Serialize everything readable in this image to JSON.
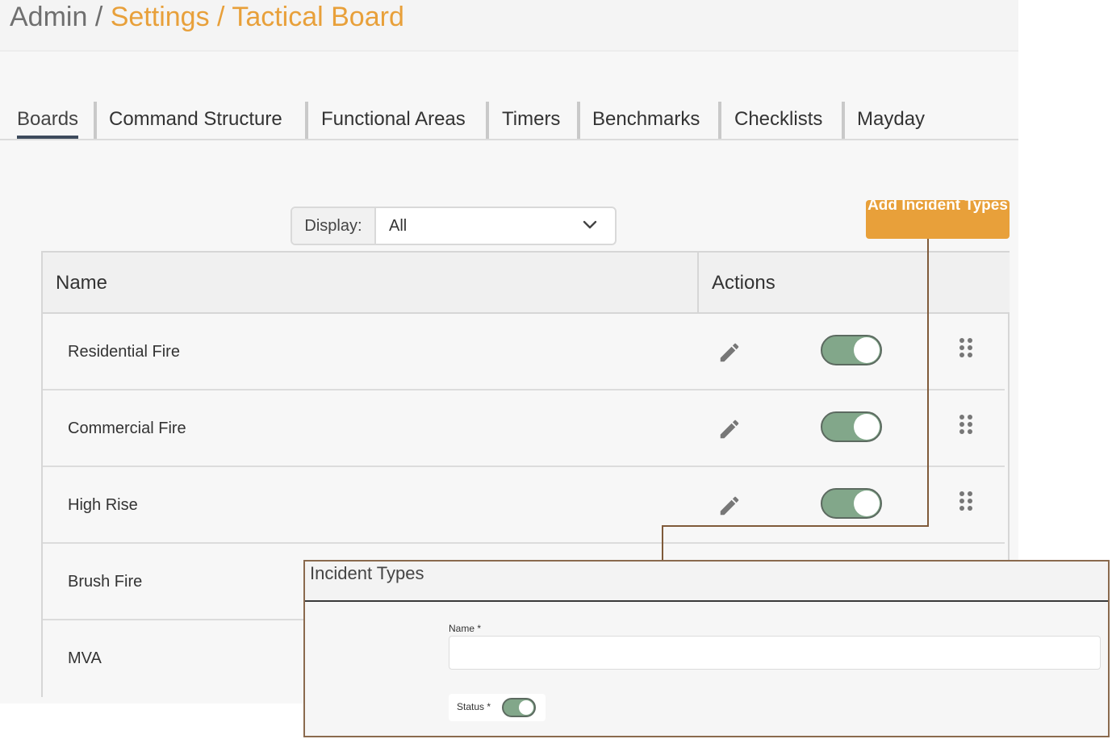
{
  "breadcrumb": {
    "root": "Admin",
    "separator1": " / ",
    "settings": "Settings",
    "separator2": " / ",
    "current": "Tactical Board"
  },
  "tabs": [
    {
      "label": "Boards",
      "active": true
    },
    {
      "label": "Command Structure",
      "active": false
    },
    {
      "label": "Functional Areas",
      "active": false
    },
    {
      "label": "Timers",
      "active": false
    },
    {
      "label": "Benchmarks",
      "active": false
    },
    {
      "label": "Checklists",
      "active": false
    },
    {
      "label": "Mayday",
      "active": false
    }
  ],
  "filter": {
    "label": "Display:",
    "value": "All"
  },
  "add_button": {
    "label": "Add Incident Types"
  },
  "table": {
    "columns": [
      "Name",
      "Actions"
    ],
    "rows": [
      {
        "name": "Residential Fire",
        "enabled": true
      },
      {
        "name": "Commercial Fire",
        "enabled": true
      },
      {
        "name": "High Rise",
        "enabled": true
      },
      {
        "name": "Brush Fire",
        "enabled": true
      },
      {
        "name": "MVA",
        "enabled": true
      }
    ]
  },
  "modal": {
    "title": "Incident Types",
    "name_label": "Name *",
    "name_value": "",
    "status_label": "Status *",
    "status_enabled": true
  },
  "colors": {
    "accent": "#e8a03a",
    "toggle_on": "#82a78a",
    "connector": "#7f5a3a",
    "tab_underline": "#3d4a5c"
  },
  "icons": {
    "edit": "pencil-icon",
    "drag": "drag-handle-icon",
    "dropdown": "chevron-down-icon"
  }
}
